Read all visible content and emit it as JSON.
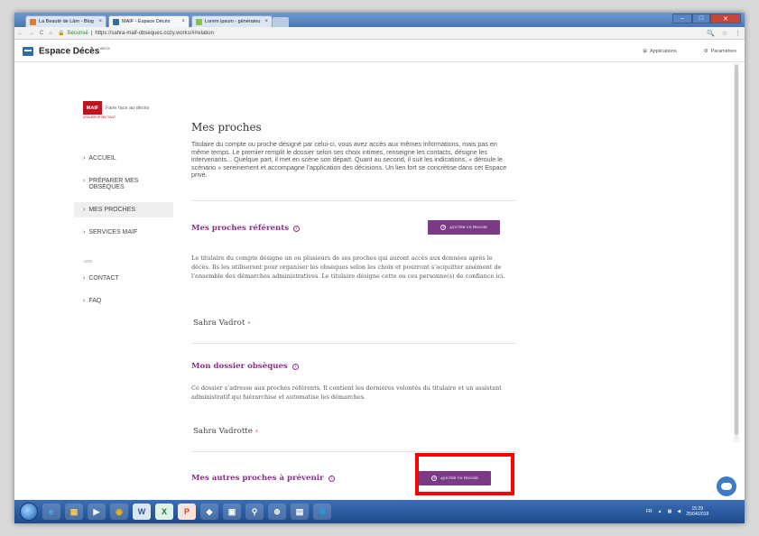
{
  "browser": {
    "tabs": [
      {
        "label": "La Beauté de Lâm - Blog",
        "icon_color": "#e07a2e"
      },
      {
        "label": "MAIF - Espace Décès",
        "icon_color": "#2e6ca8"
      },
      {
        "label": "Lorem ipsum - générateu",
        "icon_color": "#8ac53f"
      }
    ],
    "secure_label": "Sécurisé",
    "url": "https://sahra-maif-obseques.cozy.works/#/relation"
  },
  "app": {
    "title": "Espace Décès",
    "beta": "BETA",
    "applications_label": "Applications",
    "settings_label": "Paramètres"
  },
  "sidebar": {
    "brand_logo": "MAIF",
    "brand_tagline": "Faire face au décès",
    "brand_sub": "ASSUREUR MILITANT",
    "items": [
      {
        "label": "ACCUEIL"
      },
      {
        "label": "PRÉPARER MES OBSÈQUES"
      },
      {
        "label": "MES PROCHES",
        "active": true
      },
      {
        "label": "SERVICES MAIF"
      }
    ],
    "group_label": "AIDE",
    "help_items": [
      {
        "label": "CONTACT"
      },
      {
        "label": "FAQ"
      }
    ]
  },
  "main": {
    "title": "Mes proches",
    "intro": "Titulaire du compte ou proche désigné par celui-ci, vous avez accès aux mêmes informations, mais pas en même temps. Le premier remplit le dossier selon ses choix intimes, renseigne les contacts, désigne les intervenants... Quelque part, il met en scène son départ. Quant au second, il suit les indications, « déroule le scénario » sereinement et accompagne l’application des décisions. Un lien fort se concrétise dans cet Espace privé.",
    "referents": {
      "title": "Mes proches référents",
      "button": "AJOUTER UN PROCHE",
      "text": "Le titulaire du compte désigne un ou plusieurs de ses proches qui auront accès aux données après le décès. Ils les utiliseront pour organiser les obsèques selon les choix et pourront s’acquitter aisément de l’ensemble des démarches administratives. Le titulaire désigne cette ou ces personne(s) de confiance ici.",
      "person": "Sahra Vadrot"
    },
    "dossier": {
      "title": "Mon dossier obsèques",
      "text": "Ce dossier s’adresse aux proches référents. Il contient les dernières volontés du titulaire et un assistant administratif qui hiérarchise et automatise les démarches.",
      "person": "Sahra Vadrotte"
    },
    "autres": {
      "title": "Mes autres proches à prévenir",
      "button": "AJOUTER UN PROCHE"
    }
  },
  "taskbar": {
    "lang": "FR",
    "time": "15:29",
    "date": "25/04/2018"
  }
}
